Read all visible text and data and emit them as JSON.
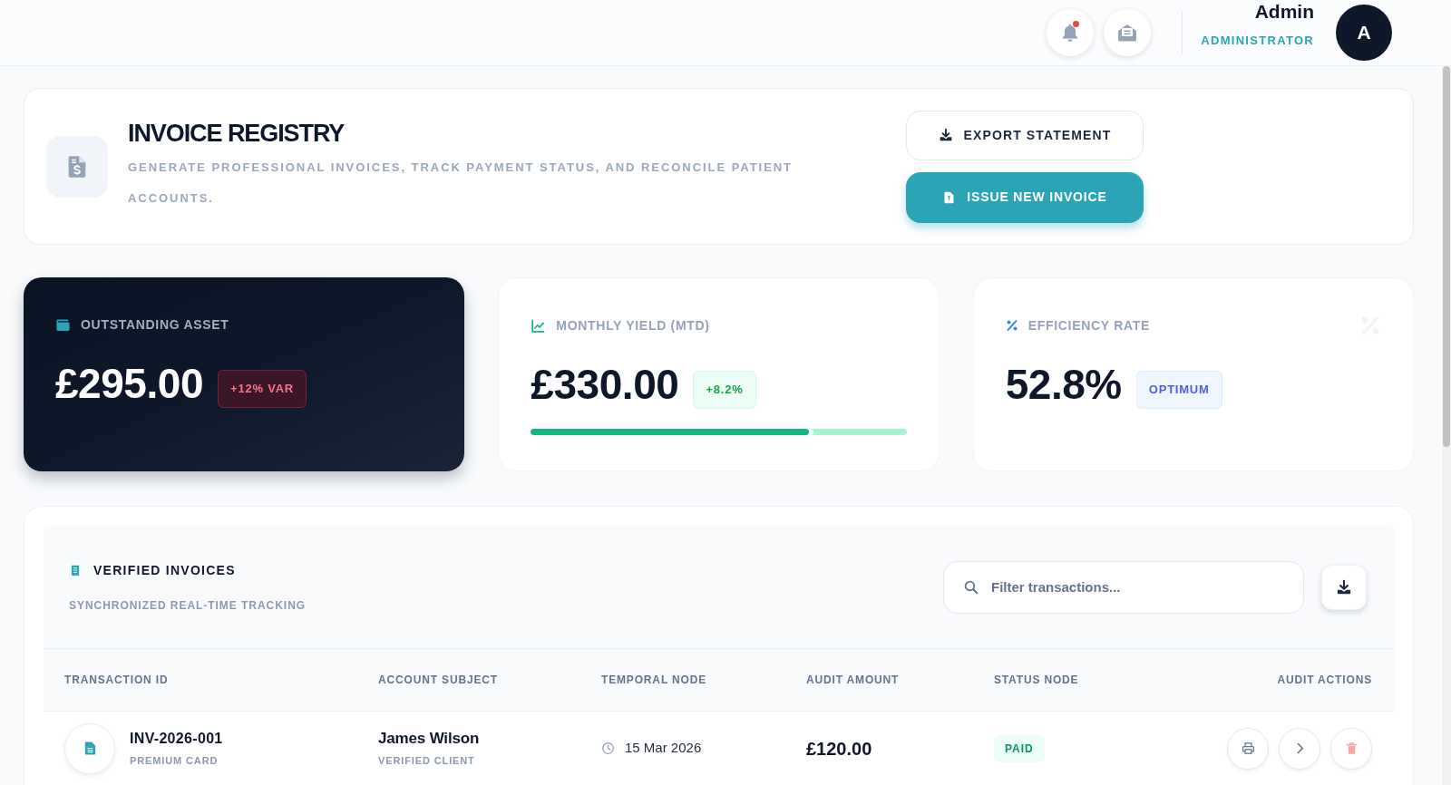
{
  "top_bar": {
    "notifications": {
      "unread": true
    },
    "user": {
      "name": "Admin",
      "role": "ADMINISTRATOR",
      "initial": "A"
    }
  },
  "header": {
    "title": "INVOICE REGISTRY",
    "description": "GENERATE PROFESSIONAL INVOICES, TRACK PAYMENT STATUS, AND RECONCILE PATIENT ACCOUNTS.",
    "buttons": [
      {
        "label": "EXPORT STATEMENT",
        "kind": "secondary"
      },
      {
        "label": "ISSUE NEW INVOICE",
        "kind": "primary"
      }
    ]
  },
  "stats": [
    {
      "kind": "balance",
      "label": "OUTSTANDING ASSET",
      "value": "£295.00",
      "badge": "+12% VAR"
    },
    {
      "kind": "yield",
      "label": "MONTHLY YIELD (MTD)",
      "value": "£330.00",
      "badge": "+8.2%",
      "level": 0.74
    },
    {
      "kind": "rate",
      "label": "EFFICIENCY RATE",
      "value": "52.8%",
      "badge": "OPTIMUM"
    }
  ],
  "invoices": {
    "title": "VERIFIED INVOICES",
    "subtitle": "SYNCHRONIZED REAL-TIME TRACKING",
    "search": {
      "placeholder": "Filter transactions..."
    },
    "table": {
      "columns": [
        "TRANSACTION ID",
        "ACCOUNT SUBJECT",
        "TEMPORAL NODE",
        "AUDIT AMOUNT",
        "STATUS NODE",
        "AUDIT ACTIONS"
      ],
      "rows": [
        {
          "id": "INV-2026-001",
          "id_note": "PREMIUM CARD",
          "subject": "James Wilson",
          "subject_note": "VERIFIED CLIENT",
          "date": "15 Mar 2026",
          "amount": "£120.00",
          "status": "PAID"
        }
      ]
    }
  }
}
